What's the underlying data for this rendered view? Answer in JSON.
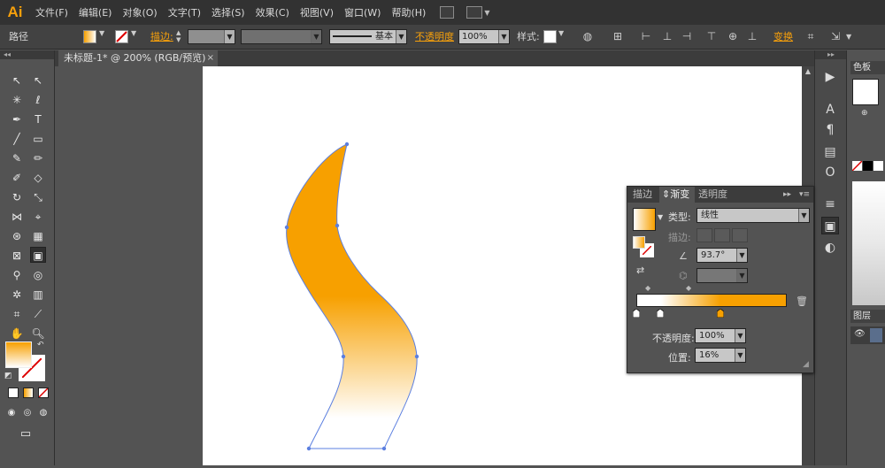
{
  "app": {
    "logo": "Ai"
  },
  "menu": [
    "文件(F)",
    "编辑(E)",
    "对象(O)",
    "文字(T)",
    "选择(S)",
    "效果(C)",
    "视图(V)",
    "窗口(W)",
    "帮助(H)"
  ],
  "controlbar": {
    "selection_label": "路径",
    "stroke_label": "描边:",
    "brush_label": "基本",
    "opacity_label": "不透明度",
    "opacity_value": "100%",
    "style_label": "样式:",
    "transform_label": "变换"
  },
  "document": {
    "tab_title": "未标题-1* @ 200% (RGB/预览)",
    "close": "×"
  },
  "gradient_panel": {
    "tabs": [
      "描边",
      "渐变",
      "透明度"
    ],
    "type_label": "类型:",
    "type_value": "线性",
    "stroke_label": "描边:",
    "angle_value": "93.7°",
    "opacity_label": "不透明度:",
    "opacity_value": "100%",
    "position_label": "位置:",
    "position_value": "16%",
    "ramp_start_color": "#ffffff",
    "ramp_end_color": "#f7a000"
  },
  "right_panels": {
    "color_tab": "色板",
    "layers_tab": "图层"
  },
  "shape": {
    "fill_top": "#f7a000",
    "fill_bottom": "#ffffff",
    "stroke": "#5b7fe0"
  }
}
